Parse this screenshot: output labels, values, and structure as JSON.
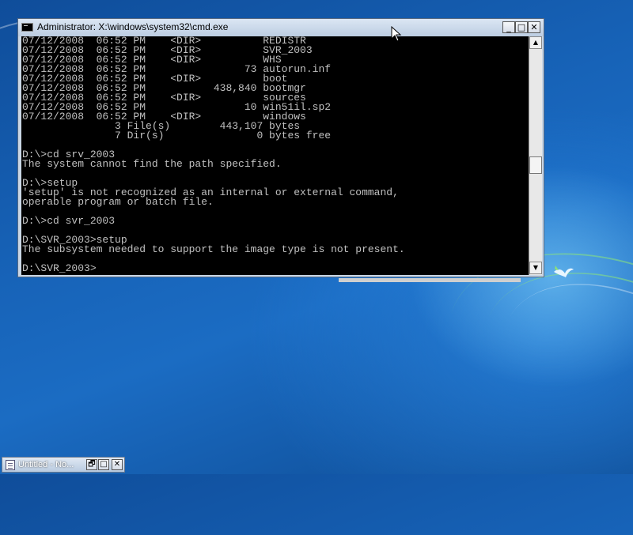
{
  "window": {
    "title": "Administrator: X:\\windows\\system32\\cmd.exe",
    "controls": {
      "minimize": "_",
      "maximize": "□",
      "close": "✕"
    },
    "icon": "cmd-icon"
  },
  "console": {
    "lines": [
      "07/12/2008  06:52 PM    <DIR>          REDISTR",
      "07/12/2008  06:52 PM    <DIR>          SVR_2003",
      "07/12/2008  06:52 PM    <DIR>          WHS",
      "07/12/2008  06:52 PM                73 autorun.inf",
      "07/12/2008  06:52 PM    <DIR>          boot",
      "07/12/2008  06:52 PM           438,840 bootmgr",
      "07/12/2008  06:52 PM    <DIR>          sources",
      "07/12/2008  06:52 PM                10 win51il.sp2",
      "07/12/2008  06:52 PM    <DIR>          windows",
      "               3 File(s)        443,107 bytes",
      "               7 Dir(s)               0 bytes free",
      "",
      "D:\\>cd srv_2003",
      "The system cannot find the path specified.",
      "",
      "D:\\>setup",
      "'setup' is not recognized as an internal or external command,",
      "operable program or batch file.",
      "",
      "D:\\>cd svr_2003",
      "",
      "D:\\SVR_2003>setup",
      "The subsystem needed to support the image type is not present.",
      "",
      "D:\\SVR_2003>"
    ]
  },
  "scrollbar": {
    "up_arrow": "▲",
    "down_arrow": "▼",
    "position": 0.5
  },
  "taskbar_window": {
    "title": "Untitled - No...",
    "icon": "notepad-icon",
    "controls": {
      "restore": "🗗",
      "maximize": "□",
      "close": "✕"
    }
  },
  "colors": {
    "console_bg": "#000000",
    "console_text": "#c0c0c0",
    "titlebar": "#c9d6e5",
    "desktop": "#1763b8"
  }
}
